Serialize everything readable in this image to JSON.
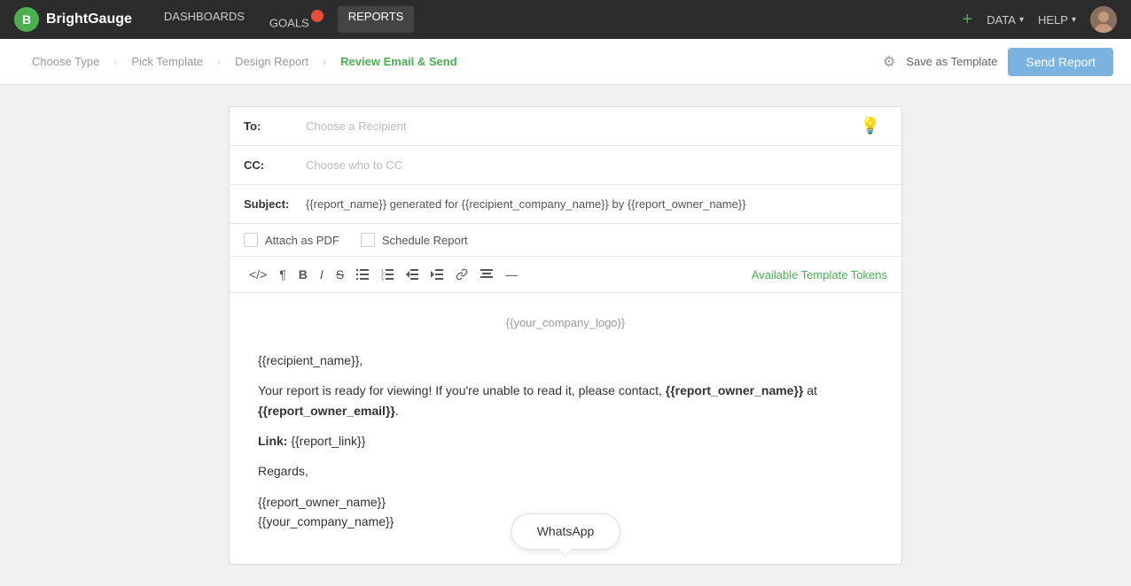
{
  "brand": {
    "name": "BrightGauge"
  },
  "nav": {
    "links": [
      {
        "label": "DASHBOARDS",
        "active": false
      },
      {
        "label": "GOALS",
        "active": false,
        "badge": ""
      },
      {
        "label": "REPORTS",
        "active": true
      }
    ],
    "data_label": "DATA",
    "help_label": "HELP",
    "plus_symbol": "+"
  },
  "steps": {
    "items": [
      {
        "label": "Choose Type",
        "active": false
      },
      {
        "label": "Pick Template",
        "active": false
      },
      {
        "label": "Design Report",
        "active": false
      },
      {
        "label": "Review Email & Send",
        "active": true
      }
    ],
    "save_template": "Save as Template",
    "send_report": "Send Report"
  },
  "email": {
    "to_label": "To:",
    "to_placeholder": "Choose a Recipient",
    "cc_label": "CC:",
    "cc_placeholder": "Choose who to CC",
    "subject_label": "Subject:",
    "subject_value": "{{report_name}} generated for {{recipient_company_name}} by {{report_owner_name}}",
    "attach_pdf_label": "Attach as PDF",
    "schedule_report_label": "Schedule Report",
    "available_tokens_label": "Available Template Tokens",
    "body": {
      "logo_token": "{{your_company_logo}}",
      "greeting": "{{recipient_name}},",
      "message": "Your report is ready for viewing! If you're unable to read it, please contact, ",
      "owner_token": "{{report_owner_name}}",
      "at_text": " at ",
      "email_token": "{{report_owner_email}}",
      "period": ".",
      "link_label": "Link:",
      "link_token": "{{report_link}}",
      "regards": "Regards,",
      "owner_name_token": "{{report_owner_name}}",
      "company_token": "{{your_company_name}}"
    },
    "whatsapp_label": "WhatsApp"
  },
  "toolbar": {
    "code": "</>",
    "paragraph": "¶",
    "bold": "B",
    "italic": "I",
    "strikethrough": "S",
    "unordered_list": "•≡",
    "ordered_list": "1≡",
    "outdent": "⇤",
    "indent": "⇥",
    "link": "🔗",
    "align": "≡",
    "hr": "—"
  }
}
